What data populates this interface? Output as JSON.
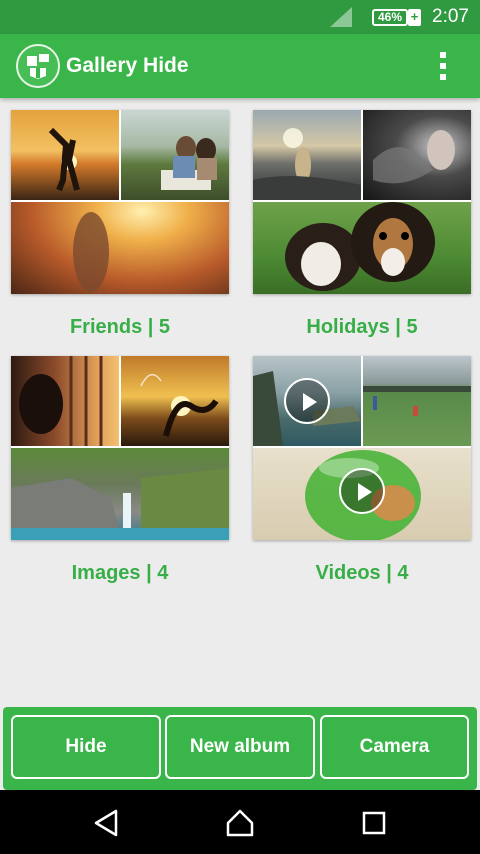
{
  "status_bar": {
    "battery": "46%",
    "battery_plus": "+",
    "time": "2:07"
  },
  "app_bar": {
    "title": "Gallery Hide",
    "logo_icon": "gallery-hide-logo-icon",
    "overflow_icon": "more-vertical-icon"
  },
  "albums": [
    {
      "label": "Friends | 5"
    },
    {
      "label": "Holidays | 5"
    },
    {
      "label": "Images | 4"
    },
    {
      "label": "Videos | 4"
    }
  ],
  "actions": {
    "hide": "Hide",
    "new_album": "New album",
    "camera": "Camera"
  },
  "colors": {
    "accent": "#3ab54a",
    "status_bar": "#2f9a40",
    "label_text": "#37ae47"
  }
}
